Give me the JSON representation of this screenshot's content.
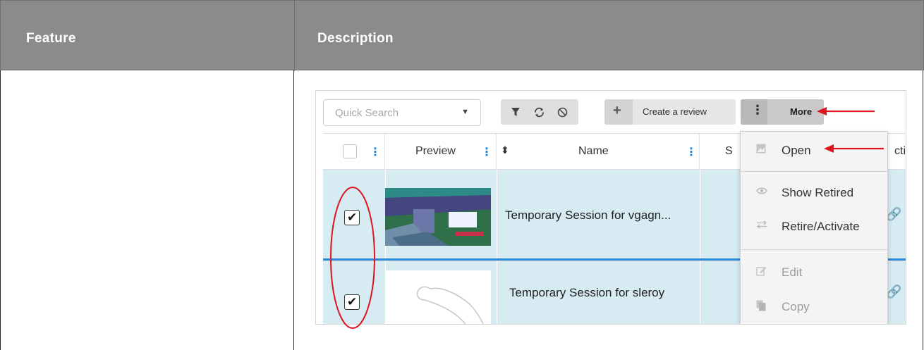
{
  "doc_table": {
    "headers": {
      "feature": "Feature",
      "description": "Description"
    }
  },
  "toolbar": {
    "search_placeholder": "Quick Search",
    "create_label": "Create a review",
    "more_label": "More"
  },
  "grid": {
    "columns": {
      "preview": "Preview",
      "name": "Name",
      "status_partial": "S",
      "action_partial": "ctio"
    },
    "rows": [
      {
        "name": "Temporary Session for vgagn...",
        "checked": true
      },
      {
        "name": "Temporary Session for sleroy",
        "checked": true
      }
    ]
  },
  "more_menu": {
    "items": [
      {
        "label": "Open",
        "icon": "image-icon"
      },
      {
        "label": "Show Retired",
        "icon": "eye-icon"
      },
      {
        "label": "Retire/Activate",
        "icon": "swap-arrows-icon"
      },
      {
        "label": "Edit",
        "icon": "edit-icon"
      },
      {
        "label": "Copy",
        "icon": "copy-icon"
      }
    ]
  },
  "colors": {
    "header_bg": "#8a8b8d",
    "row_bg": "#d6ebf2",
    "accent": "#1d86d8",
    "annotation_red": "#e0141e"
  }
}
